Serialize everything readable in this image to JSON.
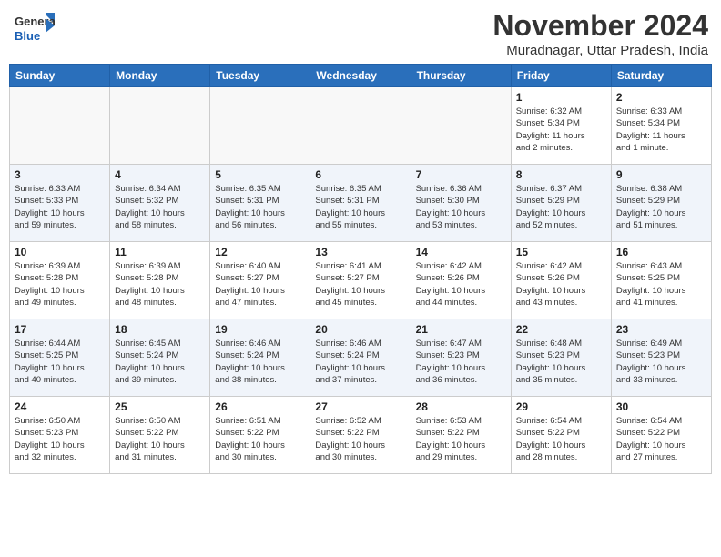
{
  "header": {
    "logo_general": "General",
    "logo_blue": "Blue",
    "month_year": "November 2024",
    "location": "Muradnagar, Uttar Pradesh, India"
  },
  "weekdays": [
    "Sunday",
    "Monday",
    "Tuesday",
    "Wednesday",
    "Thursday",
    "Friday",
    "Saturday"
  ],
  "weeks": [
    [
      {
        "day": "",
        "info": ""
      },
      {
        "day": "",
        "info": ""
      },
      {
        "day": "",
        "info": ""
      },
      {
        "day": "",
        "info": ""
      },
      {
        "day": "",
        "info": ""
      },
      {
        "day": "1",
        "info": "Sunrise: 6:32 AM\nSunset: 5:34 PM\nDaylight: 11 hours\nand 2 minutes."
      },
      {
        "day": "2",
        "info": "Sunrise: 6:33 AM\nSunset: 5:34 PM\nDaylight: 11 hours\nand 1 minute."
      }
    ],
    [
      {
        "day": "3",
        "info": "Sunrise: 6:33 AM\nSunset: 5:33 PM\nDaylight: 10 hours\nand 59 minutes."
      },
      {
        "day": "4",
        "info": "Sunrise: 6:34 AM\nSunset: 5:32 PM\nDaylight: 10 hours\nand 58 minutes."
      },
      {
        "day": "5",
        "info": "Sunrise: 6:35 AM\nSunset: 5:31 PM\nDaylight: 10 hours\nand 56 minutes."
      },
      {
        "day": "6",
        "info": "Sunrise: 6:35 AM\nSunset: 5:31 PM\nDaylight: 10 hours\nand 55 minutes."
      },
      {
        "day": "7",
        "info": "Sunrise: 6:36 AM\nSunset: 5:30 PM\nDaylight: 10 hours\nand 53 minutes."
      },
      {
        "day": "8",
        "info": "Sunrise: 6:37 AM\nSunset: 5:29 PM\nDaylight: 10 hours\nand 52 minutes."
      },
      {
        "day": "9",
        "info": "Sunrise: 6:38 AM\nSunset: 5:29 PM\nDaylight: 10 hours\nand 51 minutes."
      }
    ],
    [
      {
        "day": "10",
        "info": "Sunrise: 6:39 AM\nSunset: 5:28 PM\nDaylight: 10 hours\nand 49 minutes."
      },
      {
        "day": "11",
        "info": "Sunrise: 6:39 AM\nSunset: 5:28 PM\nDaylight: 10 hours\nand 48 minutes."
      },
      {
        "day": "12",
        "info": "Sunrise: 6:40 AM\nSunset: 5:27 PM\nDaylight: 10 hours\nand 47 minutes."
      },
      {
        "day": "13",
        "info": "Sunrise: 6:41 AM\nSunset: 5:27 PM\nDaylight: 10 hours\nand 45 minutes."
      },
      {
        "day": "14",
        "info": "Sunrise: 6:42 AM\nSunset: 5:26 PM\nDaylight: 10 hours\nand 44 minutes."
      },
      {
        "day": "15",
        "info": "Sunrise: 6:42 AM\nSunset: 5:26 PM\nDaylight: 10 hours\nand 43 minutes."
      },
      {
        "day": "16",
        "info": "Sunrise: 6:43 AM\nSunset: 5:25 PM\nDaylight: 10 hours\nand 41 minutes."
      }
    ],
    [
      {
        "day": "17",
        "info": "Sunrise: 6:44 AM\nSunset: 5:25 PM\nDaylight: 10 hours\nand 40 minutes."
      },
      {
        "day": "18",
        "info": "Sunrise: 6:45 AM\nSunset: 5:24 PM\nDaylight: 10 hours\nand 39 minutes."
      },
      {
        "day": "19",
        "info": "Sunrise: 6:46 AM\nSunset: 5:24 PM\nDaylight: 10 hours\nand 38 minutes."
      },
      {
        "day": "20",
        "info": "Sunrise: 6:46 AM\nSunset: 5:24 PM\nDaylight: 10 hours\nand 37 minutes."
      },
      {
        "day": "21",
        "info": "Sunrise: 6:47 AM\nSunset: 5:23 PM\nDaylight: 10 hours\nand 36 minutes."
      },
      {
        "day": "22",
        "info": "Sunrise: 6:48 AM\nSunset: 5:23 PM\nDaylight: 10 hours\nand 35 minutes."
      },
      {
        "day": "23",
        "info": "Sunrise: 6:49 AM\nSunset: 5:23 PM\nDaylight: 10 hours\nand 33 minutes."
      }
    ],
    [
      {
        "day": "24",
        "info": "Sunrise: 6:50 AM\nSunset: 5:23 PM\nDaylight: 10 hours\nand 32 minutes."
      },
      {
        "day": "25",
        "info": "Sunrise: 6:50 AM\nSunset: 5:22 PM\nDaylight: 10 hours\nand 31 minutes."
      },
      {
        "day": "26",
        "info": "Sunrise: 6:51 AM\nSunset: 5:22 PM\nDaylight: 10 hours\nand 30 minutes."
      },
      {
        "day": "27",
        "info": "Sunrise: 6:52 AM\nSunset: 5:22 PM\nDaylight: 10 hours\nand 30 minutes."
      },
      {
        "day": "28",
        "info": "Sunrise: 6:53 AM\nSunset: 5:22 PM\nDaylight: 10 hours\nand 29 minutes."
      },
      {
        "day": "29",
        "info": "Sunrise: 6:54 AM\nSunset: 5:22 PM\nDaylight: 10 hours\nand 28 minutes."
      },
      {
        "day": "30",
        "info": "Sunrise: 6:54 AM\nSunset: 5:22 PM\nDaylight: 10 hours\nand 27 minutes."
      }
    ]
  ]
}
